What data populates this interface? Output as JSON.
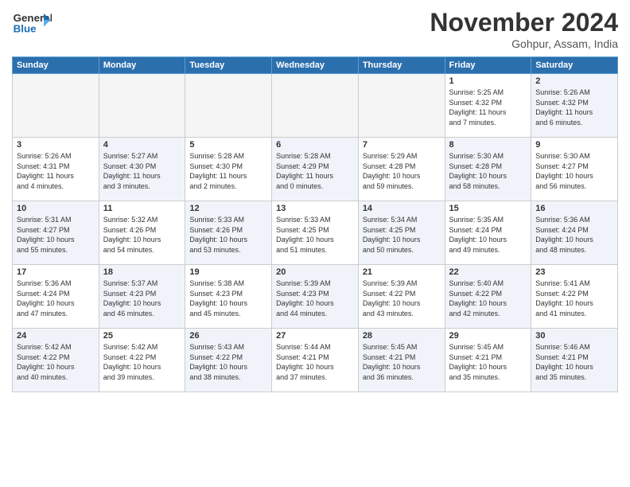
{
  "header": {
    "logo_general": "General",
    "logo_blue": "Blue",
    "month_title": "November 2024",
    "location": "Gohpur, Assam, India"
  },
  "days_of_week": [
    "Sunday",
    "Monday",
    "Tuesday",
    "Wednesday",
    "Thursday",
    "Friday",
    "Saturday"
  ],
  "weeks": [
    [
      {
        "day": "",
        "empty": true
      },
      {
        "day": "",
        "empty": true
      },
      {
        "day": "",
        "empty": true
      },
      {
        "day": "",
        "empty": true
      },
      {
        "day": "",
        "empty": true
      },
      {
        "day": "1",
        "info": "Sunrise: 5:25 AM\nSunset: 4:32 PM\nDaylight: 11 hours\nand 7 minutes."
      },
      {
        "day": "2",
        "info": "Sunrise: 5:26 AM\nSunset: 4:32 PM\nDaylight: 11 hours\nand 6 minutes."
      }
    ],
    [
      {
        "day": "3",
        "info": "Sunrise: 5:26 AM\nSunset: 4:31 PM\nDaylight: 11 hours\nand 4 minutes."
      },
      {
        "day": "4",
        "info": "Sunrise: 5:27 AM\nSunset: 4:30 PM\nDaylight: 11 hours\nand 3 minutes."
      },
      {
        "day": "5",
        "info": "Sunrise: 5:28 AM\nSunset: 4:30 PM\nDaylight: 11 hours\nand 2 minutes."
      },
      {
        "day": "6",
        "info": "Sunrise: 5:28 AM\nSunset: 4:29 PM\nDaylight: 11 hours\nand 0 minutes."
      },
      {
        "day": "7",
        "info": "Sunrise: 5:29 AM\nSunset: 4:28 PM\nDaylight: 10 hours\nand 59 minutes."
      },
      {
        "day": "8",
        "info": "Sunrise: 5:30 AM\nSunset: 4:28 PM\nDaylight: 10 hours\nand 58 minutes."
      },
      {
        "day": "9",
        "info": "Sunrise: 5:30 AM\nSunset: 4:27 PM\nDaylight: 10 hours\nand 56 minutes."
      }
    ],
    [
      {
        "day": "10",
        "info": "Sunrise: 5:31 AM\nSunset: 4:27 PM\nDaylight: 10 hours\nand 55 minutes."
      },
      {
        "day": "11",
        "info": "Sunrise: 5:32 AM\nSunset: 4:26 PM\nDaylight: 10 hours\nand 54 minutes."
      },
      {
        "day": "12",
        "info": "Sunrise: 5:33 AM\nSunset: 4:26 PM\nDaylight: 10 hours\nand 53 minutes."
      },
      {
        "day": "13",
        "info": "Sunrise: 5:33 AM\nSunset: 4:25 PM\nDaylight: 10 hours\nand 51 minutes."
      },
      {
        "day": "14",
        "info": "Sunrise: 5:34 AM\nSunset: 4:25 PM\nDaylight: 10 hours\nand 50 minutes."
      },
      {
        "day": "15",
        "info": "Sunrise: 5:35 AM\nSunset: 4:24 PM\nDaylight: 10 hours\nand 49 minutes."
      },
      {
        "day": "16",
        "info": "Sunrise: 5:36 AM\nSunset: 4:24 PM\nDaylight: 10 hours\nand 48 minutes."
      }
    ],
    [
      {
        "day": "17",
        "info": "Sunrise: 5:36 AM\nSunset: 4:24 PM\nDaylight: 10 hours\nand 47 minutes."
      },
      {
        "day": "18",
        "info": "Sunrise: 5:37 AM\nSunset: 4:23 PM\nDaylight: 10 hours\nand 46 minutes."
      },
      {
        "day": "19",
        "info": "Sunrise: 5:38 AM\nSunset: 4:23 PM\nDaylight: 10 hours\nand 45 minutes."
      },
      {
        "day": "20",
        "info": "Sunrise: 5:39 AM\nSunset: 4:23 PM\nDaylight: 10 hours\nand 44 minutes."
      },
      {
        "day": "21",
        "info": "Sunrise: 5:39 AM\nSunset: 4:22 PM\nDaylight: 10 hours\nand 43 minutes."
      },
      {
        "day": "22",
        "info": "Sunrise: 5:40 AM\nSunset: 4:22 PM\nDaylight: 10 hours\nand 42 minutes."
      },
      {
        "day": "23",
        "info": "Sunrise: 5:41 AM\nSunset: 4:22 PM\nDaylight: 10 hours\nand 41 minutes."
      }
    ],
    [
      {
        "day": "24",
        "info": "Sunrise: 5:42 AM\nSunset: 4:22 PM\nDaylight: 10 hours\nand 40 minutes."
      },
      {
        "day": "25",
        "info": "Sunrise: 5:42 AM\nSunset: 4:22 PM\nDaylight: 10 hours\nand 39 minutes."
      },
      {
        "day": "26",
        "info": "Sunrise: 5:43 AM\nSunset: 4:22 PM\nDaylight: 10 hours\nand 38 minutes."
      },
      {
        "day": "27",
        "info": "Sunrise: 5:44 AM\nSunset: 4:21 PM\nDaylight: 10 hours\nand 37 minutes."
      },
      {
        "day": "28",
        "info": "Sunrise: 5:45 AM\nSunset: 4:21 PM\nDaylight: 10 hours\nand 36 minutes."
      },
      {
        "day": "29",
        "info": "Sunrise: 5:45 AM\nSunset: 4:21 PM\nDaylight: 10 hours\nand 35 minutes."
      },
      {
        "day": "30",
        "info": "Sunrise: 5:46 AM\nSunset: 4:21 PM\nDaylight: 10 hours\nand 35 minutes."
      }
    ]
  ]
}
